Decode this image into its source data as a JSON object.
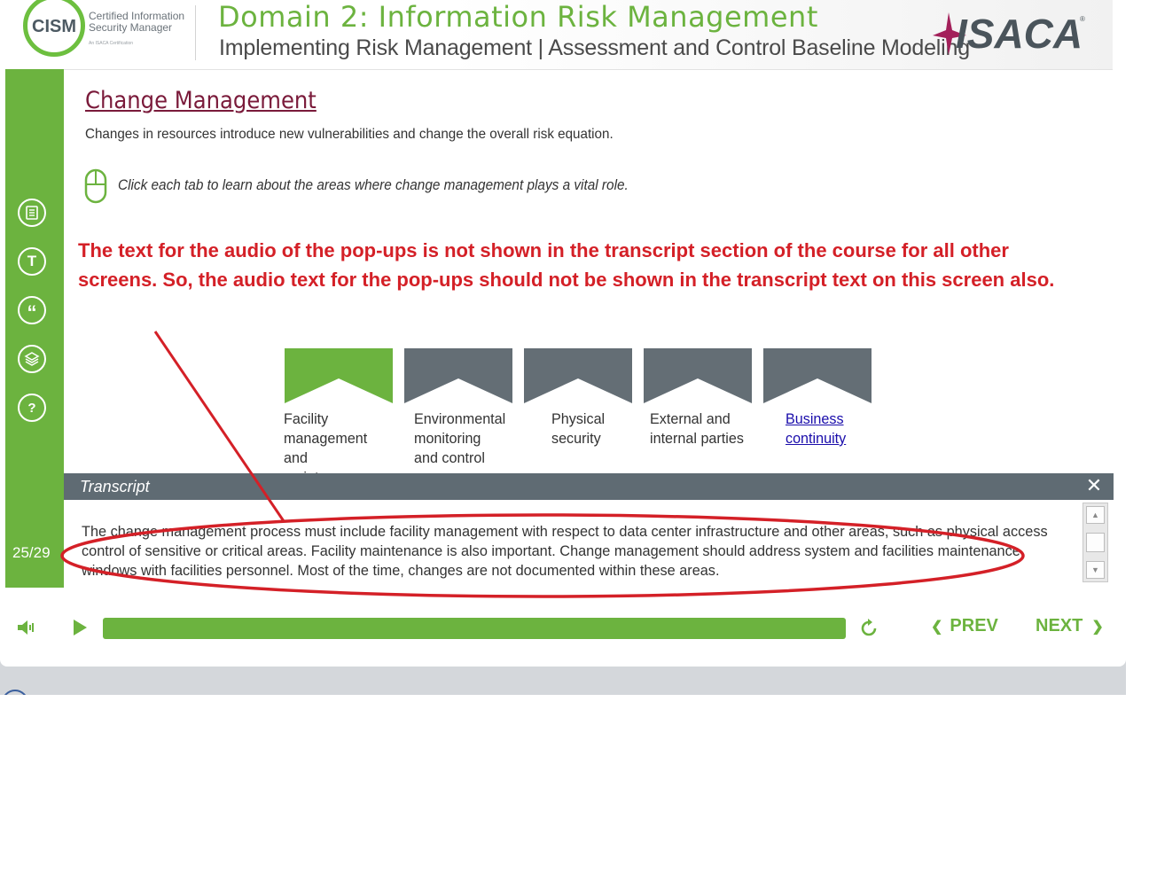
{
  "header": {
    "logo_text": "CISM",
    "logo_subtitle_line1": "Certified Information",
    "logo_subtitle_line2": "Security Manager",
    "logo_subtitle_line3": "An ISACA Certification",
    "domain_title": "Domain 2: Information Risk Management",
    "subtitle": "Implementing Risk Management | Assessment and Control Baseline Modeling",
    "brand_logo": "ISACA"
  },
  "sidebar": {
    "items": [
      {
        "icon": "notes-icon"
      },
      {
        "icon": "transcript-icon",
        "glyph": "T"
      },
      {
        "icon": "quote-icon",
        "glyph": "“"
      },
      {
        "icon": "layers-icon"
      },
      {
        "icon": "help-icon",
        "glyph": "?"
      }
    ],
    "page_counter": "25/29"
  },
  "content": {
    "title": "Change Management",
    "intro": "Changes in resources introduce new vulnerabilities and change the overall risk equation.",
    "instruction": "Click each tab to learn about the areas where change management plays a vital role.",
    "annotation": "The text for the audio of the pop-ups is not shown in the transcript section of the course for all other screens. So, the audio text for the pop-ups should not be shown in the transcript text on this screen also."
  },
  "tabs": [
    {
      "label": "Facility management and maintenance",
      "color": "#6cb33f"
    },
    {
      "label": "Environmental monitoring and control",
      "color": "#646e75"
    },
    {
      "label": "Physical security",
      "color": "#646e75"
    },
    {
      "label": "External and internal parties",
      "color": "#646e75"
    },
    {
      "label": "Business continuity",
      "color": "#646e75"
    }
  ],
  "transcript": {
    "title": "Transcript",
    "close_glyph": "✕",
    "text": "The change management process must include facility management with respect to data center infrastructure and other areas, such as physical access control of sensitive or critical areas. Facility maintenance is also important. Change management should address system and facilities maintenance windows with facilities personnel. Most of the time, changes are not documented within these areas."
  },
  "controls": {
    "prev_label": "PREV",
    "next_label": "NEXT",
    "progress": 1.0
  },
  "colors": {
    "accent": "#6cb33f",
    "title": "#7a1a3a",
    "annotation": "#d42027",
    "dark_bar": "#5f6b73"
  }
}
